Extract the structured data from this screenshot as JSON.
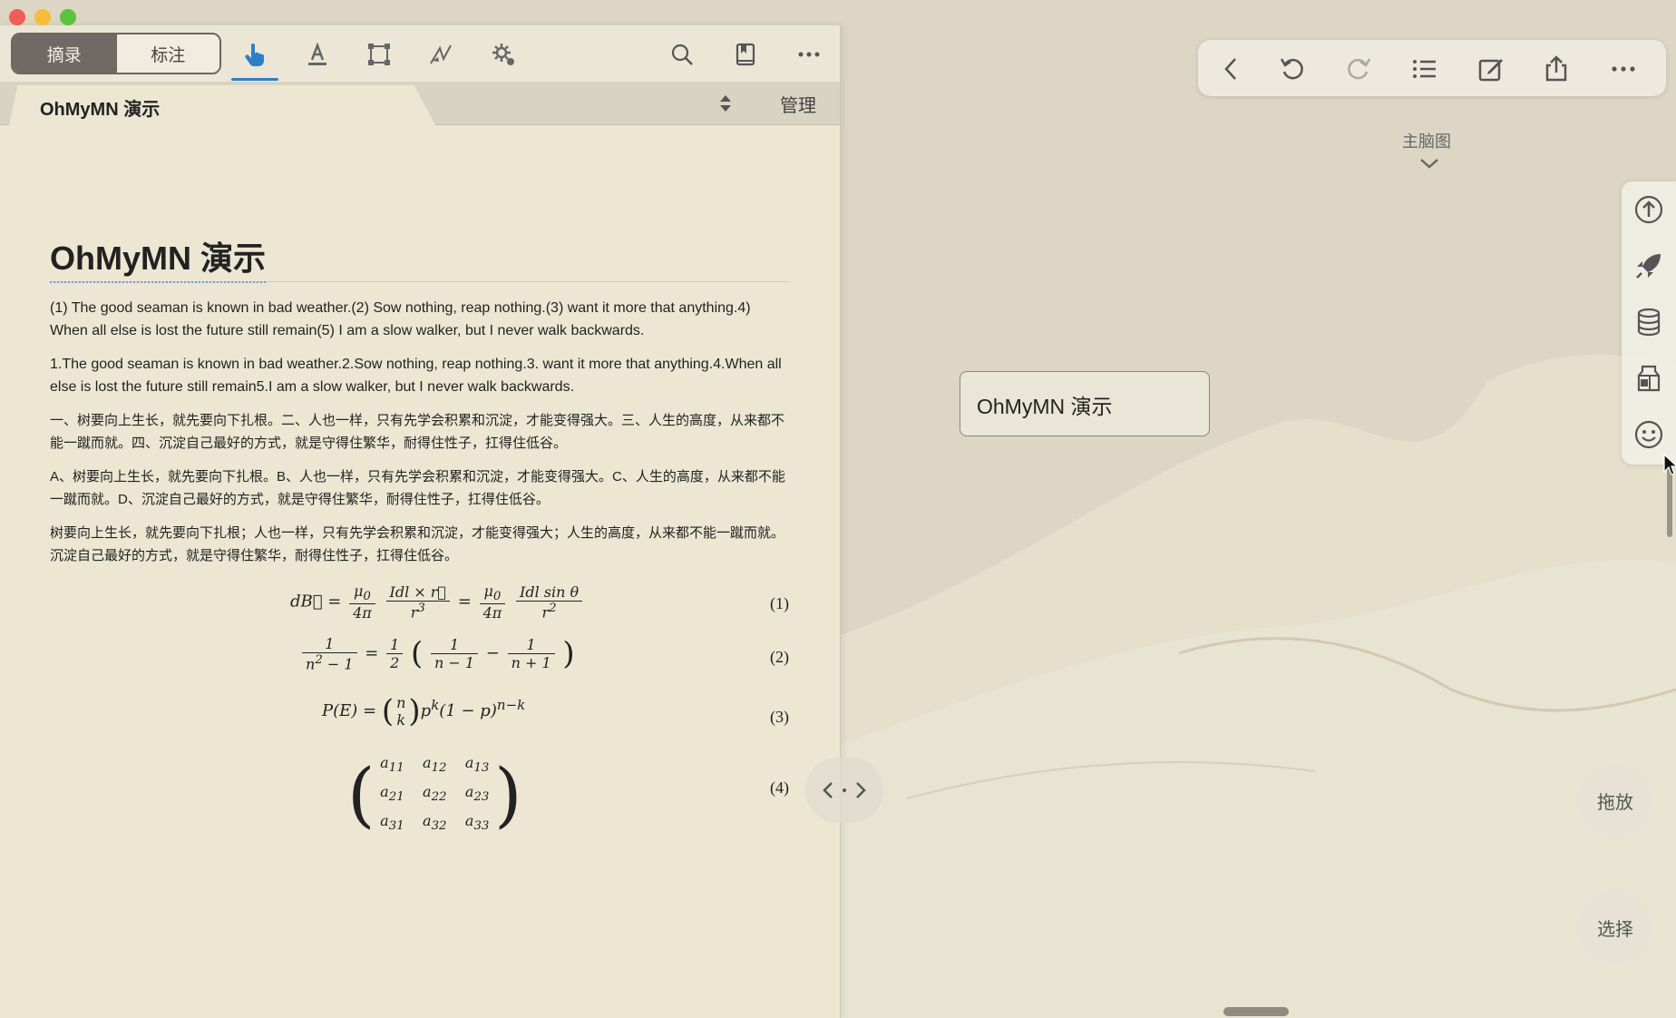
{
  "colors": {
    "accent": "#2b80c8",
    "traffic_red": "#ee5f58",
    "traffic_yellow": "#f6bd3b",
    "traffic_green": "#5ac43f"
  },
  "left_toolbar": {
    "segment": {
      "excerpt": "摘录",
      "annotate": "标注"
    },
    "icons": [
      "hand-pointer-icon",
      "text-highlight-icon",
      "rectangle-select-icon",
      "drawing-icon",
      "settings-gear-icon",
      "search-icon",
      "bookmark-icon",
      "more-icon"
    ]
  },
  "tab_row": {
    "doc_tab": "OhMyMN 演示",
    "manage": "管理"
  },
  "document": {
    "title": "OhMyMN 演示",
    "paragraphs": [
      "(1) The good seaman is known in bad weather.(2) Sow nothing, reap nothing.(3) want it more that anything.4) When all else is lost the future still remain(5) I am a slow walker, but I never walk backwards.",
      "1.The good seaman is known in bad weather.2.Sow nothing, reap nothing.3. want it more that anything.4.When all else is lost the future still remain5.I am a slow walker, but I never walk backwards.",
      "一、树要向上生长，就先要向下扎根。二、人也一样，只有先学会积累和沉淀，才能变得强大。三、人生的高度，从来都不能一蹴而就。四、沉淀自己最好的方式，就是守得住繁华，耐得住性子，扛得住低谷。",
      "A、树要向上生长，就先要向下扎根。B、人也一样，只有先学会积累和沉淀，才能变得强大。C、人生的高度，从来都不能一蹴而就。D、沉淀自己最好的方式，就是守得住繁华，耐得住性子，扛得住低谷。",
      "树要向上生长，就先要向下扎根；人也一样，只有先学会积累和沉淀，才能变得强大；人生的高度，从来都不能一蹴而就。沉淀自己最好的方式，就是守得住繁华，耐得住性子，扛得住低谷。"
    ],
    "equation_numbers": [
      "(1)",
      "(2)",
      "(3)",
      "(4)"
    ]
  },
  "right": {
    "nav_icons": [
      "back-icon",
      "undo-icon",
      "redo-icon",
      "outline-list-icon",
      "edit-icon",
      "share-icon",
      "more-icon"
    ],
    "mindmap_label": "主脑图",
    "node_text": "OhMyMN 演示",
    "side_icons": [
      "upload-icon",
      "rocket-icon",
      "database-icon",
      "milk-box-icon",
      "smiley-icon"
    ],
    "drag_label": "拖放",
    "select_label": "选择"
  }
}
